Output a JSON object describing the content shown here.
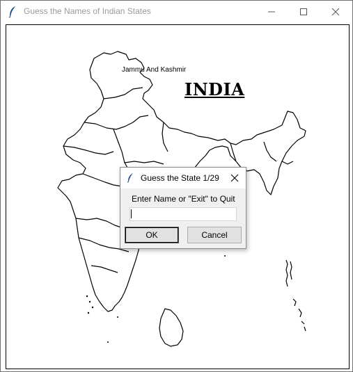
{
  "window": {
    "title": "Guess the Names of Indian States",
    "controls": {
      "minimize": "minimize-icon",
      "maximize": "maximize-icon",
      "close": "close-icon"
    }
  },
  "canvas": {
    "state_label": "Jammu And Kashmir",
    "heading": "INDIA"
  },
  "dialog": {
    "title": "Guess the State 1/29",
    "prompt": "Enter Name or \"Exit\" to Quit",
    "input_value": "",
    "ok_label": "OK",
    "cancel_label": "Cancel"
  },
  "colors": {
    "window_bg": "#ffffff",
    "dialog_bg": "#f0f0f0",
    "map_stroke": "#000000"
  }
}
